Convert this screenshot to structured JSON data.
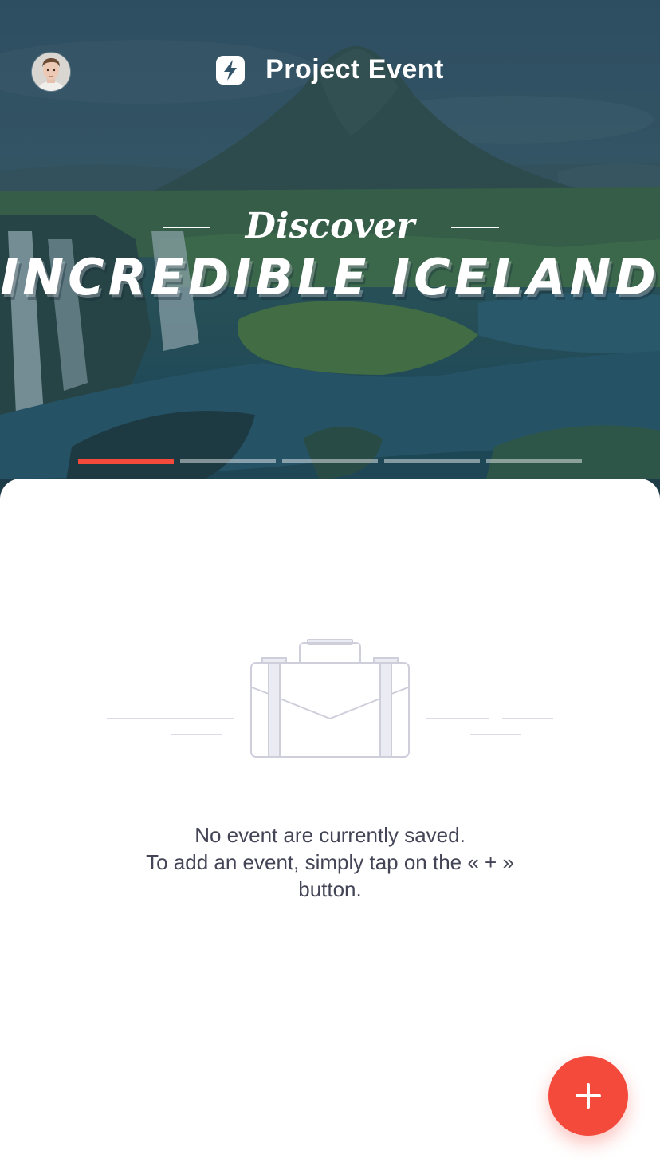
{
  "app": {
    "title": "Project Event",
    "logo_icon": "lightning-bolt-icon"
  },
  "hero": {
    "discover": "Discover",
    "headline": "INCREDIBLE ICELAND",
    "slides_total": 5,
    "slide_active": 1
  },
  "empty_state": {
    "illustration_icon": "briefcase-icon",
    "line1": "No event are currently saved.",
    "line2": "To add an event, simply tap on the « + »",
    "line3": "button."
  },
  "fab": {
    "icon": "plus-icon"
  },
  "colors": {
    "accent": "#f44a3b",
    "text": "#434456",
    "illustration_stroke": "#cfcfdc",
    "illustration_fill": "#ebebf3"
  }
}
